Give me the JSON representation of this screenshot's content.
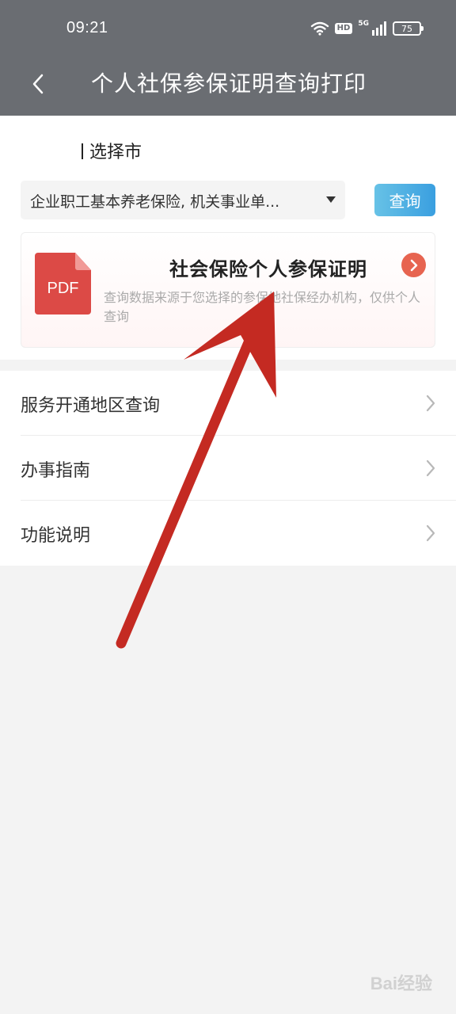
{
  "status_bar": {
    "time": "09:21",
    "hd_label": "HD",
    "network_label": "5G",
    "battery_level": "75"
  },
  "nav": {
    "title": "个人社保参保证明查询打印"
  },
  "city": {
    "label": "选择市"
  },
  "insurance": {
    "selected": "企业职工基本养老保险, 机关事业单..."
  },
  "query_button": {
    "label": "查询"
  },
  "certificate": {
    "icon_text": "PDF",
    "title": "社会保险个人参保证明",
    "description": "查询数据来源于您选择的参保地社保经办机构，仅供个人查询"
  },
  "menu": [
    {
      "label": "服务开通地区查询"
    },
    {
      "label": "办事指南"
    },
    {
      "label": "功能说明"
    }
  ],
  "watermark": {
    "text": "Bai经验"
  },
  "colors": {
    "header_bg": "#6a6d72",
    "query_btn": "#3a9fe0",
    "pdf_red": "#dc4a46",
    "go_btn": "#e76450",
    "annotation_arrow": "#c42a22"
  }
}
